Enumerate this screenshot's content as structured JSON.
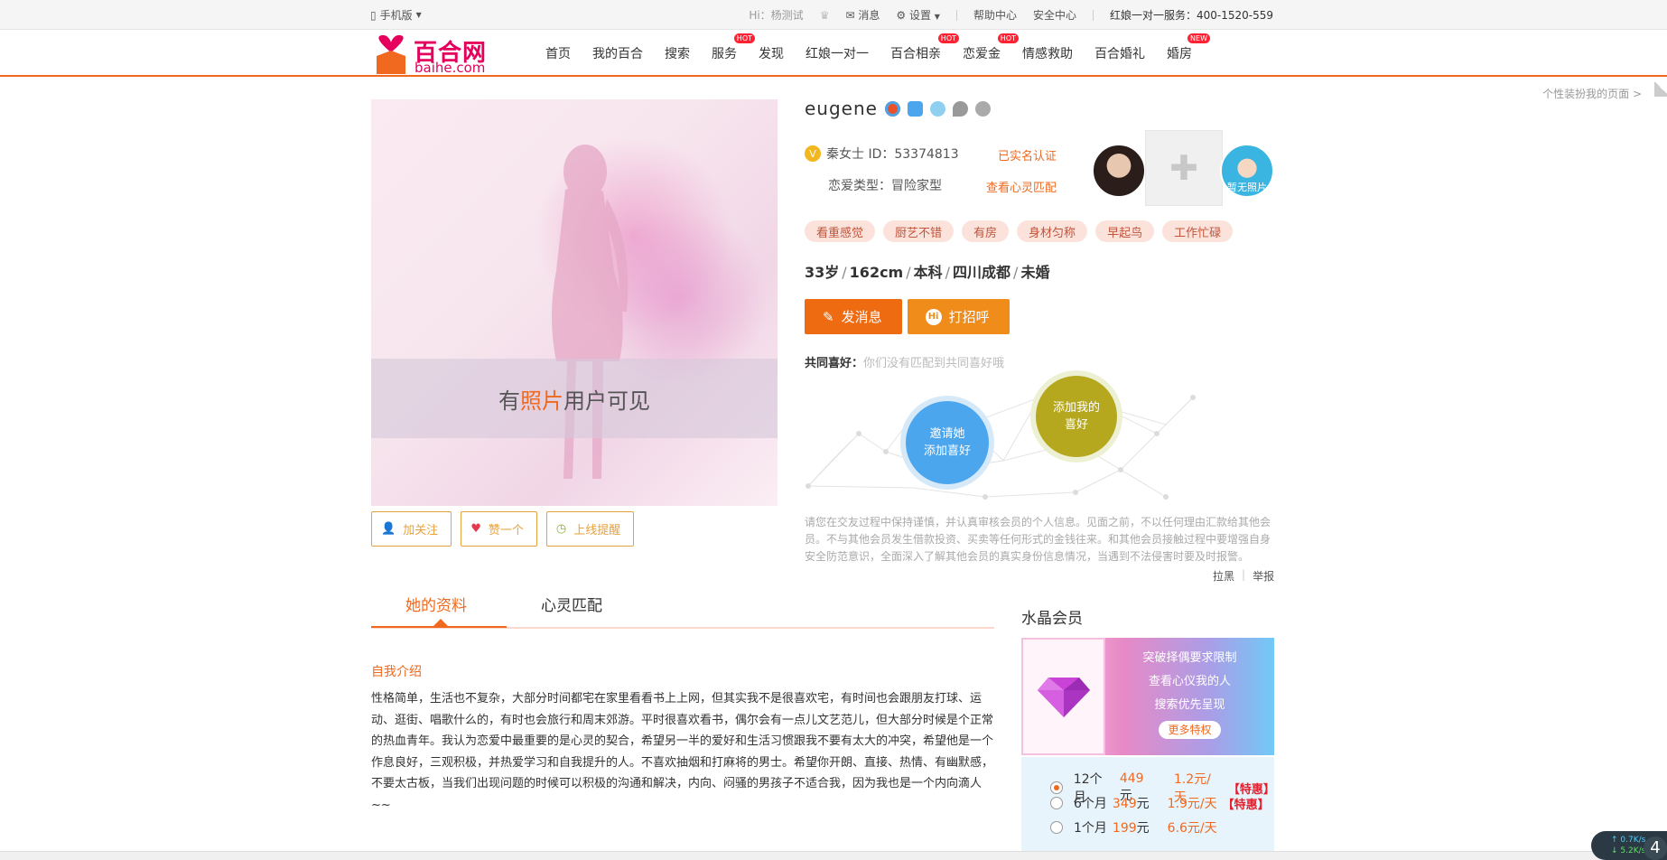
{
  "topbar": {
    "mobile": "手机版",
    "greeting": "Hi：杨测试",
    "messages": "消息",
    "settings": "设置",
    "help": "帮助中心",
    "security": "安全中心",
    "hotline": "红娘一对一服务：400-1520-559"
  },
  "header": {
    "logo_cn": "百合网",
    "logo_en": "baihe.com",
    "nav": [
      {
        "label": "首页",
        "badge": ""
      },
      {
        "label": "我的百合",
        "badge": ""
      },
      {
        "label": "搜索",
        "badge": ""
      },
      {
        "label": "服务",
        "badge": "HOT"
      },
      {
        "label": "发现",
        "badge": ""
      },
      {
        "label": "红娘一对一",
        "badge": ""
      },
      {
        "label": "百合相亲",
        "badge": "HOT"
      },
      {
        "label": "恋爱金",
        "badge": "HOT"
      },
      {
        "label": "情感救助",
        "badge": ""
      },
      {
        "label": "百合婚礼",
        "badge": ""
      },
      {
        "label": "婚房",
        "badge": "NEW"
      }
    ],
    "personalize": "个性装扮我的页面 >"
  },
  "photo": {
    "band_pre": "有",
    "band_highlight": "照片",
    "band_post": "用户可见",
    "buttons": {
      "follow": "加关注",
      "like": "赞一个",
      "online_alert": "上线提醒"
    }
  },
  "profile": {
    "name": "eugene",
    "vip_mark": "V",
    "id_text": "秦女士 ID：53374813",
    "verified": "已实名认证",
    "love_type": "恋爱类型：冒险家型",
    "heart_match": "查看心灵匹配",
    "avatar_placeholder": "暂无照片",
    "tags": [
      "看重感觉",
      "厨艺不错",
      "有房",
      "身材匀称",
      "早起鸟",
      "工作忙碌"
    ],
    "stats": [
      "33岁",
      "162cm",
      "本科",
      "四川成都",
      "未婚"
    ],
    "send_message": "发消息",
    "greet": "打招呼",
    "greet_icon": "Hi",
    "common_label": "共同喜好：",
    "common_text": "你们没有匹配到共同喜好哦",
    "invite_bubble": [
      "邀请她",
      "添加喜好"
    ],
    "add_bubble": [
      "添加我的",
      "喜好"
    ],
    "disclaimer": "请您在交友过程中保持谨慎，并认真审核会员的个人信息。见面之前，不以任何理由汇款给其他会员。不与其他会员发生借款投资、买卖等任何形式的金钱往来。和其他会员接触过程中要增强自身安全防范意识，全面深入了解其他会员的真实身份信息情况，当遇到不法侵害时要及时报警。",
    "block": "拉黑",
    "report": "举报"
  },
  "tabs": {
    "active": "她的资料",
    "inactive": "心灵匹配"
  },
  "intro": {
    "title": "自我介绍",
    "body": "性格简单，生活也不复杂，大部分时间都宅在家里看看书上上网，但其实我不是很喜欢宅，有时间也会跟朋友打球、运动、逛街、唱歌什么的，有时也会旅行和周末郊游。平时很喜欢看书，偶尔会有一点儿文艺范儿，但大部分时候是个正常的热血青年。我认为恋爱中最重要的是心灵的契合，希望另一半的爱好和生活习惯跟我不要有太大的冲突，希望他是一个作息良好，三观积极，并热爱学习和自我提升的人。不喜欢抽烟和打麻将的男士。希望你开朗、直接、热情、有幽默感，不要太古板，当我们出现问题的时候可以积极的沟通和解决，内向、闷骚的男孩子不适合我，因为我也是一个内向滴人~~"
  },
  "vip": {
    "title": "水晶会员",
    "lines": [
      "突破择偶要求限制",
      "查看心仪我的人",
      "搜索优先呈现"
    ],
    "more": "更多特权",
    "plans": [
      {
        "period": "12个月",
        "price": "449",
        "unit": "元",
        "perday": "1.2元/天",
        "special": "【特惠】",
        "selected": true
      },
      {
        "period": "6个月",
        "price": "349",
        "unit": "元",
        "perday": "1.9元/天",
        "special": "【特惠】",
        "selected": false
      },
      {
        "period": "1个月",
        "price": "199",
        "unit": "元",
        "perday": "6.6元/天",
        "special": "",
        "selected": false
      }
    ]
  },
  "speed": {
    "up": "0.7K/s",
    "down": "5.2K/s",
    "num": "4"
  },
  "colors": {
    "brand": "#f0691f",
    "pink": "#e4005c",
    "tag_bg": "#fbe3dc"
  }
}
